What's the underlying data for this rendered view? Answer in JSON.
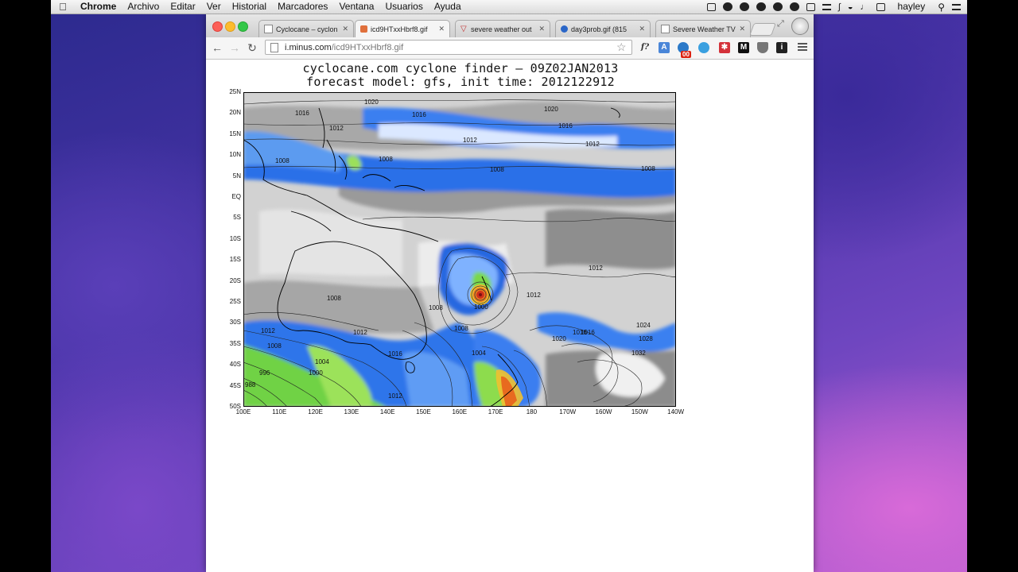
{
  "menubar": {
    "app": "Chrome",
    "items": [
      "Archivo",
      "Editar",
      "Ver",
      "Historial",
      "Marcadores",
      "Ventana",
      "Usuarios",
      "Ayuda"
    ],
    "user": "hayley"
  },
  "tabs": [
    {
      "label": "Cyclocane – cyclon",
      "active": false
    },
    {
      "label": "icd9HTxxHbrf8.gif",
      "active": true
    },
    {
      "label": "severe weather out",
      "active": false
    },
    {
      "label": "day3prob.gif (815",
      "active": false
    },
    {
      "label": "Severe Weather TV",
      "active": false
    }
  ],
  "address": {
    "host": "i.minus.com",
    "path": "/icd9HTxxHbrf8.gif"
  },
  "extensions": {
    "badge": "00"
  },
  "figure": {
    "title_line1": "cyclocane.com cyclone finder – 09Z02JAN2013",
    "title_line2": "forecast model: gfs, init time: 2012122912",
    "lat_labels": [
      "25N",
      "20N",
      "15N",
      "10N",
      "5N",
      "EQ",
      "5S",
      "10S",
      "15S",
      "20S",
      "25S",
      "30S",
      "35S",
      "40S",
      "45S",
      "50S"
    ],
    "lon_labels": [
      "100E",
      "110E",
      "120E",
      "130E",
      "140E",
      "150E",
      "160E",
      "170E",
      "180",
      "170W",
      "160W",
      "150W",
      "140W"
    ],
    "isobar_labels": [
      "1020",
      "1016",
      "1012",
      "1020",
      "1016",
      "1016",
      "1012",
      "1012",
      "1008",
      "1008",
      "1008",
      "1008",
      "1008",
      "1012",
      "1012",
      "1012",
      "1000",
      "1008",
      "1008",
      "1016",
      "1016",
      "1020",
      "1024",
      "1028",
      "1032",
      "1012",
      "1008",
      "1004",
      "1000",
      "996",
      "988",
      "1004",
      "1016",
      "1012"
    ]
  }
}
